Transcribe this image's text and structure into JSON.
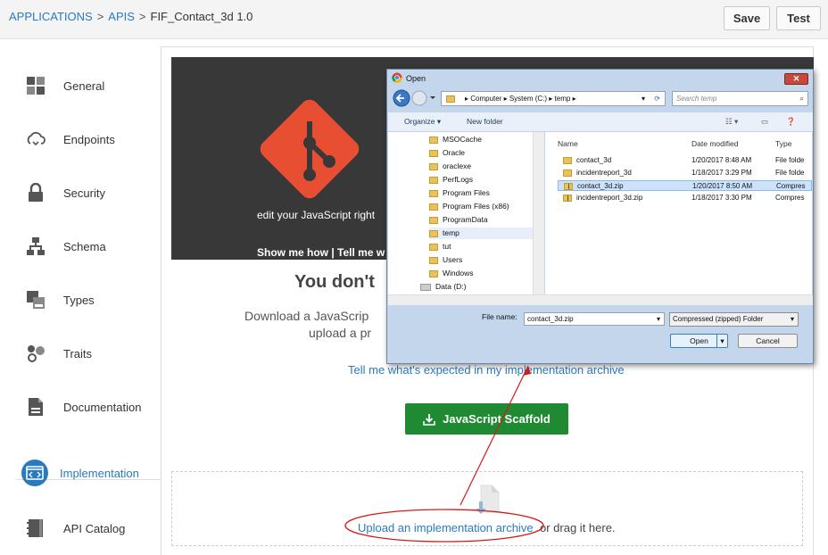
{
  "breadcrumb": {
    "applications": "APPLICATIONS",
    "separator": ">",
    "apis": "APIS",
    "current": "FIF_Contact_3d  1.0"
  },
  "header": {
    "save_label": "Save",
    "test_label": "Test"
  },
  "sidebar": {
    "items": [
      {
        "label": "General",
        "icon": "grid-icon"
      },
      {
        "label": "Endpoints",
        "icon": "cloud-icon"
      },
      {
        "label": "Security",
        "icon": "lock-icon"
      },
      {
        "label": "Schema",
        "icon": "hierarchy-icon"
      },
      {
        "label": "Types",
        "icon": "types-icon"
      },
      {
        "label": "Traits",
        "icon": "traits-icon"
      },
      {
        "label": "Documentation",
        "icon": "document-icon"
      },
      {
        "label": "Implementation",
        "icon": "code-icon",
        "active": true
      },
      {
        "label": "API Catalog",
        "icon": "catalog-icon"
      }
    ],
    "active_color": "#2a7ac0"
  },
  "main": {
    "hero_text": "edit your JavaScript right",
    "hero_links": "Show me how | Tell me w",
    "heading": "You don't",
    "download_line1": "Download a JavaScrip",
    "download_line2": "upload a pr",
    "expected_link": "Tell me what's expected in my implementation archive",
    "scaffold_button": "JavaScript Scaffold",
    "upload_link": "Upload an implementation archive",
    "drag_text": "or drag it here.",
    "scaffold_color": "#1f8a32",
    "annotation_color": "#d21c1c"
  },
  "dialog": {
    "title": "Open",
    "address": [
      "Computer",
      "System (C:)",
      "temp"
    ],
    "search_placeholder": "Search temp",
    "organize": "Organize ▾",
    "new_folder": "New folder",
    "tree": [
      "MSOCache",
      "Oracle",
      "oraclexe",
      "PerfLogs",
      "Program Files",
      "Program Files (x86)",
      "ProgramData",
      "temp",
      "tut",
      "Users",
      "Windows",
      "Data (D:)"
    ],
    "columns": {
      "name": "Name",
      "date": "Date modified",
      "type": "Type"
    },
    "files": [
      {
        "name": "contact_3d",
        "date": "1/20/2017 8:48 AM",
        "type": "File folde"
      },
      {
        "name": "incidentreport_3d",
        "date": "1/18/2017 3:29 PM",
        "type": "File folde"
      },
      {
        "name": "contact_3d.zip",
        "date": "1/20/2017 8:50 AM",
        "type": "Compres"
      },
      {
        "name": "incidentreport_3d.zip",
        "date": "1/18/2017 3:30 PM",
        "type": "Compres"
      }
    ],
    "file_name_label": "File name:",
    "file_name_value": "contact_3d.zip",
    "file_type": "Compressed (zipped) Folder",
    "open_label": "Open",
    "cancel_label": "Cancel"
  }
}
